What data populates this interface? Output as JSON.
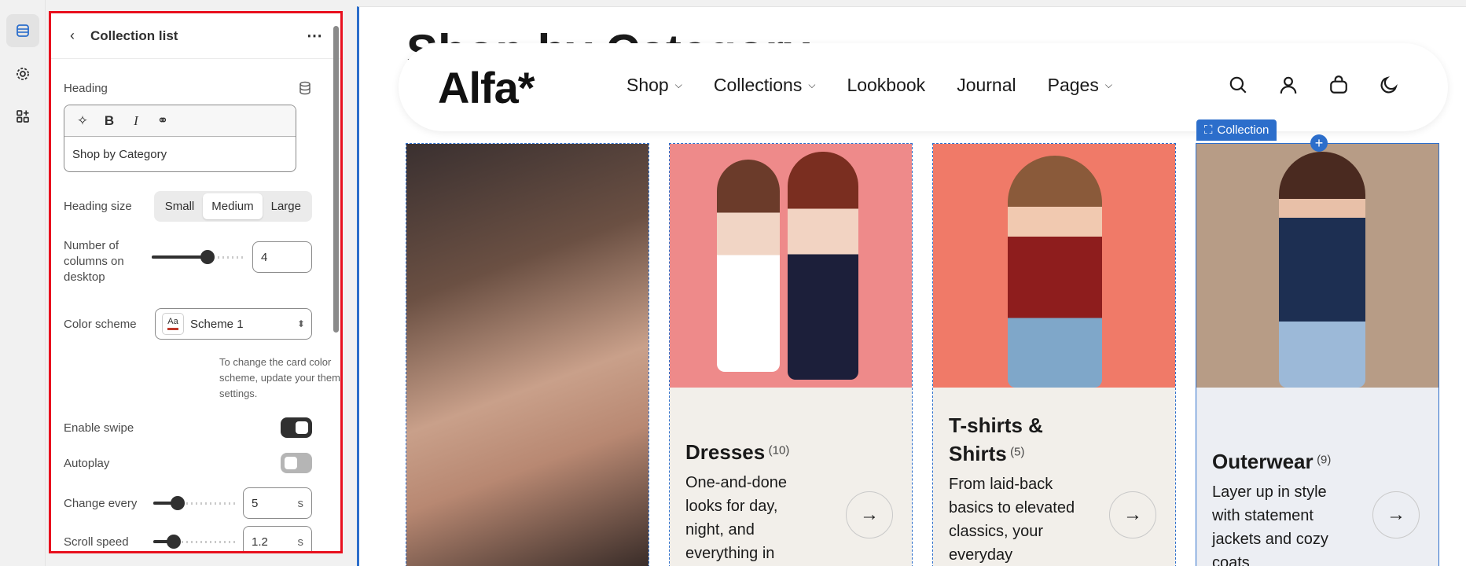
{
  "panel": {
    "title": "Collection list",
    "heading_label": "Heading",
    "heading_value": "Shop by Category",
    "heading_size_label": "Heading size",
    "heading_size_options": [
      "Small",
      "Medium",
      "Large"
    ],
    "heading_size_selected": "Medium",
    "columns_label_1": "Number of",
    "columns_label_2": "columns on",
    "columns_label_3": "desktop",
    "columns_value": "4",
    "columns_fraction": 0.6,
    "color_scheme_label": "Color scheme",
    "color_scheme_value": "Scheme 1",
    "color_scheme_swatch": "Aa",
    "color_scheme_hint": "To change the card color scheme, update your theme settings.",
    "enable_swipe_label": "Enable swipe",
    "enable_swipe_on": true,
    "autoplay_label": "Autoplay",
    "autoplay_on": false,
    "change_every_label": "Change every",
    "change_every_value": "5",
    "change_every_unit": "s",
    "change_every_fraction": 0.3,
    "scroll_speed_label": "Scroll speed",
    "scroll_speed_value": "1.2",
    "scroll_speed_unit": "s",
    "scroll_speed_fraction": 0.25
  },
  "preview": {
    "bg_title": "Shop by Category",
    "logo": "Alfa*",
    "nav": [
      "Shop",
      "Collections",
      "Lookbook",
      "Journal",
      "Pages"
    ],
    "selection_tag": "Collection",
    "cards": [
      {
        "title": "Dresses",
        "count": "(10)",
        "desc": "One-and-done looks for day, night, and everything in"
      },
      {
        "title": "T-shirts & Shirts",
        "count": "(5)",
        "desc": "From laid-back basics to elevated classics, your everyday"
      },
      {
        "title": "Outerwear",
        "count": "(9)",
        "desc": "Layer up in style with statement jackets and cozy coats"
      }
    ]
  },
  "colors": {
    "selection": "#2c6ecb",
    "highlight": "#e8101e"
  }
}
